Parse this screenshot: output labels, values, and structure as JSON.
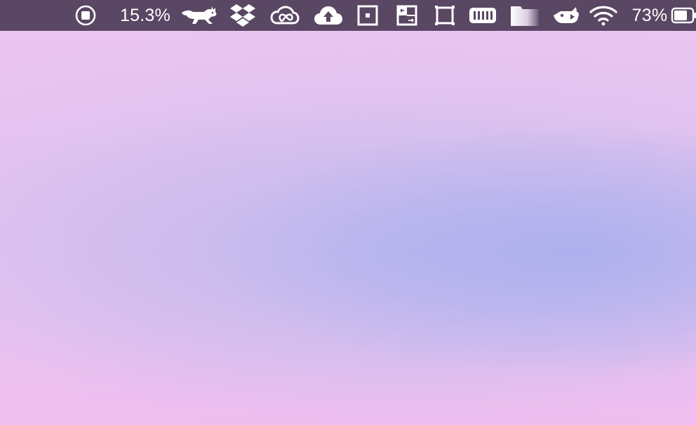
{
  "menubar": {
    "cpu_usage": "15.3%",
    "battery_percent": "73%",
    "battery_level": 0.73,
    "icons": [
      "record-stop-icon",
      "runcat-icon",
      "dropbox-icon",
      "creative-cloud-icon",
      "cloud-upload-icon",
      "window-center-icon",
      "window-swap-icon",
      "window-fullscreen-icon",
      "memory-meter-icon",
      "folder-icon",
      "bird-tag-icon",
      "wifi-icon",
      "battery-icon"
    ]
  },
  "colors": {
    "menubar_bg": "#5a4763",
    "wallpaper_pink": "#ecc6f2",
    "wallpaper_lavender": "#b0aff0"
  }
}
